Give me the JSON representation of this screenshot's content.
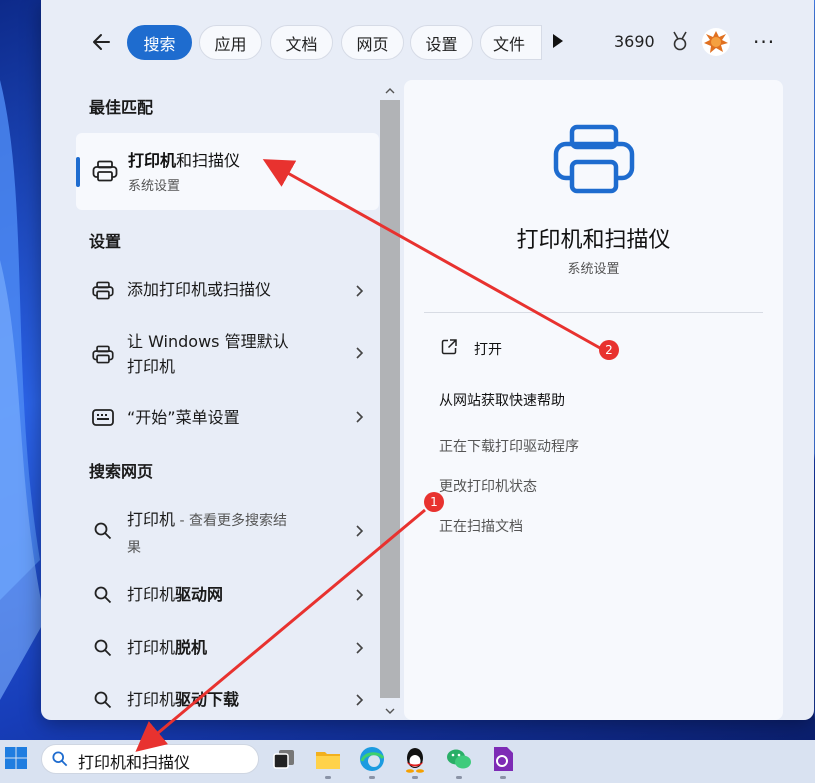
{
  "tabs": [
    {
      "label": "搜索",
      "active": true
    },
    {
      "label": "应用",
      "active": false
    },
    {
      "label": "文档",
      "active": false
    },
    {
      "label": "网页",
      "active": false
    },
    {
      "label": "设置",
      "active": false
    },
    {
      "label": "文件",
      "active": false
    }
  ],
  "header": {
    "points": "3690"
  },
  "left": {
    "best_match_heading": "最佳匹配",
    "best_match": {
      "title_bold": "打印机",
      "title_rest": "和扫描仪",
      "subtitle": "系统设置"
    },
    "settings_heading": "设置",
    "settings_items": [
      {
        "label": "添加打印机或扫描仪"
      },
      {
        "label_line1": "让 Windows 管理默认",
        "label_line2": "打印机"
      },
      {
        "label": "“开始”菜单设置"
      }
    ],
    "web_heading": "搜索网页",
    "web_items": [
      {
        "plain": "打印机",
        "hint": " - 查看更多搜索结",
        "hint2": "果"
      },
      {
        "plain": "打印机",
        "bold": "驱动网"
      },
      {
        "plain": "打印机",
        "bold": "脱机"
      },
      {
        "plain": "打印机",
        "bold": "驱动下载"
      }
    ]
  },
  "right": {
    "title": "打印机和扫描仪",
    "subtitle": "系统设置",
    "open_label": "打开",
    "help_title": "从网站获取快速帮助",
    "help_links": [
      "正在下载打印驱动程序",
      "更改打印机状态",
      "正在扫描文档"
    ]
  },
  "annotations": {
    "badge1": "1",
    "badge2": "2"
  },
  "taskbar": {
    "search_value": "打印机和扫描仪"
  },
  "colors": {
    "accent": "#1e6ccf",
    "arrow": "#e8322f"
  }
}
